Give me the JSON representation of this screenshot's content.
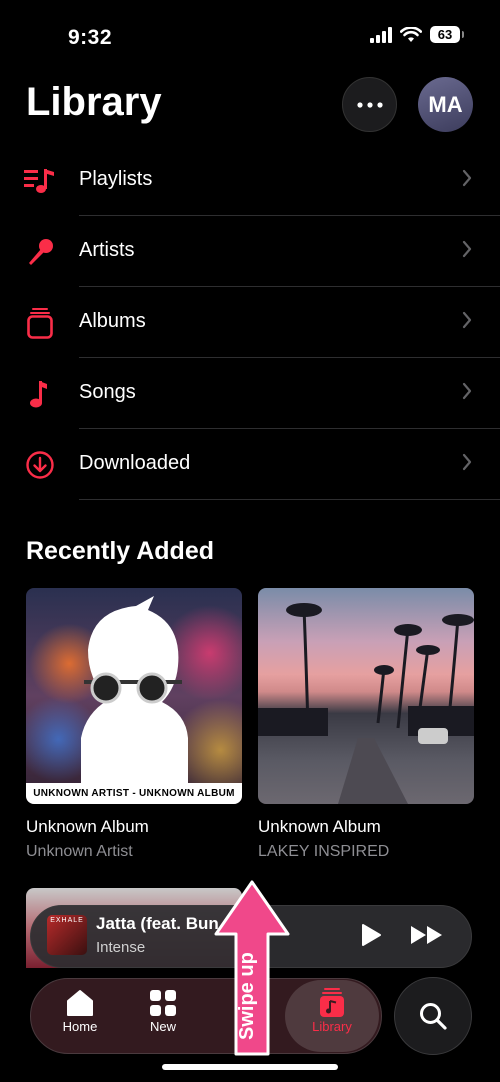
{
  "status_bar": {
    "time": "9:32",
    "battery": "63"
  },
  "header": {
    "title": "Library",
    "avatar_initials": "MA"
  },
  "library_items": [
    {
      "label": "Playlists",
      "icon": "playlists-icon"
    },
    {
      "label": "Artists",
      "icon": "microphone-icon"
    },
    {
      "label": "Albums",
      "icon": "albums-icon"
    },
    {
      "label": "Songs",
      "icon": "music-note-icon"
    },
    {
      "label": "Downloaded",
      "icon": "download-icon"
    }
  ],
  "recently_added": {
    "title": "Recently Added",
    "albums": [
      {
        "name": "Unknown Album",
        "artist": "Unknown Artist",
        "art_caption": "UNKNOWN ARTIST - UNKNOWN ALBUM"
      },
      {
        "name": "Unknown Album",
        "artist": "LAKEY INSPIRED"
      }
    ]
  },
  "mini_player": {
    "title": "Jatta (feat. Bun",
    "artist": "Intense",
    "art_text": "EXHALE"
  },
  "tabs": [
    {
      "label": "Home",
      "icon": "home-icon"
    },
    {
      "label": "New",
      "icon": "grid-icon"
    },
    {
      "label": "Library",
      "icon": "library-icon",
      "active": true
    }
  ],
  "annotation": {
    "text": "Swipe up"
  },
  "colors": {
    "accent": "#fa2d48",
    "background": "#000000",
    "annotation": "#f0488a"
  }
}
